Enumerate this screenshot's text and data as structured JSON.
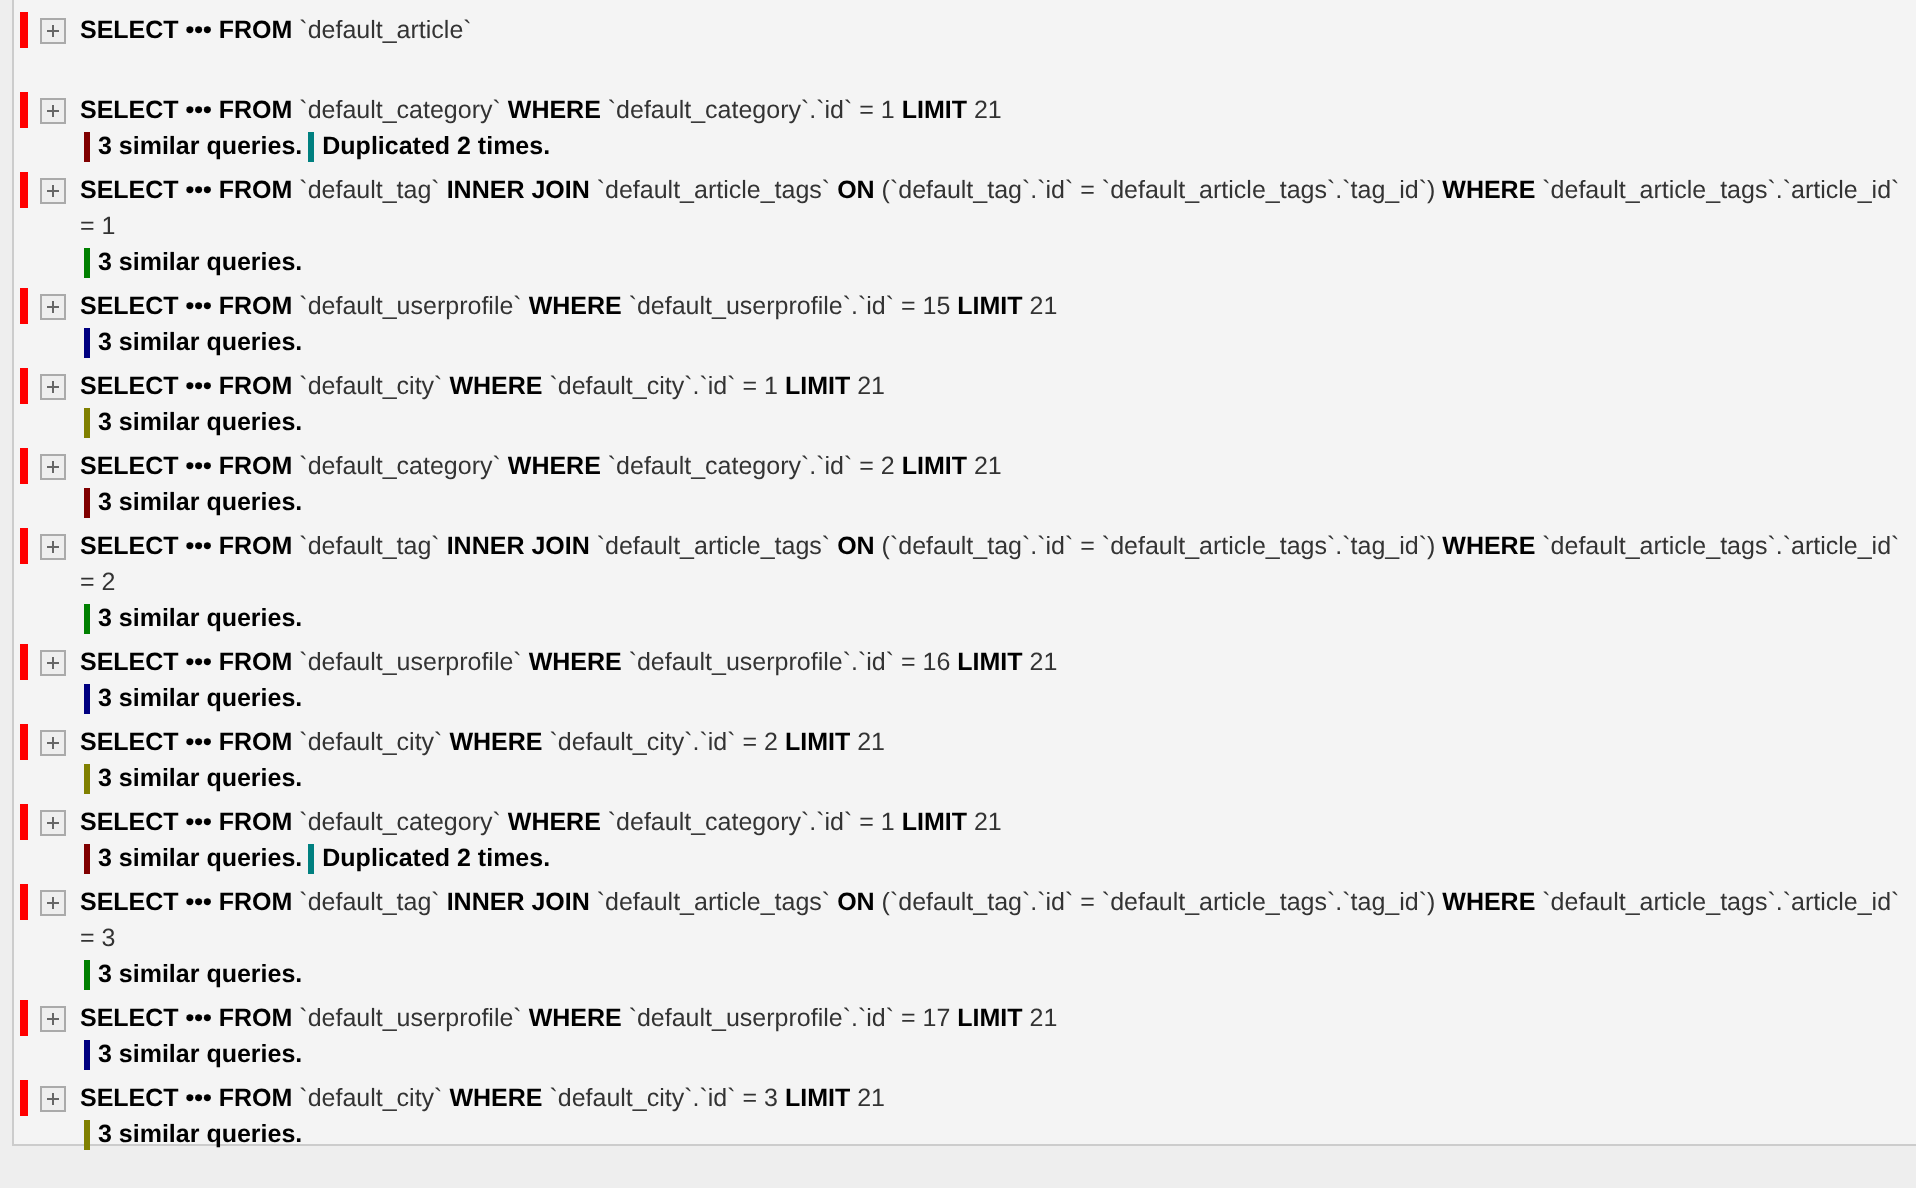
{
  "queries": [
    {
      "sql": "**SELECT ••• FROM** `default_article`"
    },
    {
      "sql": "**SELECT ••• FROM** `default_category` **WHERE** `default_category`.`id` = 1 **LIMIT** 21",
      "notes": [
        {
          "text": "3 similar queries.",
          "color": "#800000"
        },
        {
          "text": "Duplicated 2 times.",
          "color": "#008080"
        }
      ]
    },
    {
      "sql": "**SELECT ••• FROM** `default_tag` **INNER JOIN** `default_article_tags` **ON** (`default_tag`.`id` = `default_article_tags`.`tag_id`) **WHERE** `default_article_tags`.`article_id` = 1",
      "notes": [
        {
          "text": "3 similar queries.",
          "color": "#008000"
        }
      ]
    },
    {
      "sql": "**SELECT ••• FROM** `default_userprofile` **WHERE** `default_userprofile`.`id` = 15 **LIMIT** 21",
      "notes": [
        {
          "text": "3 similar queries.",
          "color": "#000080"
        }
      ]
    },
    {
      "sql": "**SELECT ••• FROM** `default_city` **WHERE** `default_city`.`id` = 1 **LIMIT** 21",
      "notes": [
        {
          "text": "3 similar queries.",
          "color": "#808000"
        }
      ]
    },
    {
      "sql": "**SELECT ••• FROM** `default_category` **WHERE** `default_category`.`id` = 2 **LIMIT** 21",
      "notes": [
        {
          "text": "3 similar queries.",
          "color": "#800000"
        }
      ]
    },
    {
      "sql": "**SELECT ••• FROM** `default_tag` **INNER JOIN** `default_article_tags` **ON** (`default_tag`.`id` = `default_article_tags`.`tag_id`) **WHERE** `default_article_tags`.`article_id` = 2",
      "notes": [
        {
          "text": "3 similar queries.",
          "color": "#008000"
        }
      ]
    },
    {
      "sql": "**SELECT ••• FROM** `default_userprofile` **WHERE** `default_userprofile`.`id` = 16 **LIMIT** 21",
      "notes": [
        {
          "text": "3 similar queries.",
          "color": "#000080"
        }
      ]
    },
    {
      "sql": "**SELECT ••• FROM** `default_city` **WHERE** `default_city`.`id` = 2 **LIMIT** 21",
      "notes": [
        {
          "text": "3 similar queries.",
          "color": "#808000"
        }
      ]
    },
    {
      "sql": "**SELECT ••• FROM** `default_category` **WHERE** `default_category`.`id` = 1 **LIMIT** 21",
      "notes": [
        {
          "text": "3 similar queries.",
          "color": "#800000"
        },
        {
          "text": "Duplicated 2 times.",
          "color": "#008080"
        }
      ]
    },
    {
      "sql": "**SELECT ••• FROM** `default_tag` **INNER JOIN** `default_article_tags` **ON** (`default_tag`.`id` = `default_article_tags`.`tag_id`) **WHERE** `default_article_tags`.`article_id` = 3",
      "notes": [
        {
          "text": "3 similar queries.",
          "color": "#008000"
        }
      ]
    },
    {
      "sql": "**SELECT ••• FROM** `default_userprofile` **WHERE** `default_userprofile`.`id` = 17 **LIMIT** 21",
      "notes": [
        {
          "text": "3 similar queries.",
          "color": "#000080"
        }
      ]
    },
    {
      "sql": "**SELECT ••• FROM** `default_city` **WHERE** `default_city`.`id` = 3 **LIMIT** 21",
      "notes": [
        {
          "text": "3 similar queries.",
          "color": "#808000"
        }
      ]
    }
  ]
}
